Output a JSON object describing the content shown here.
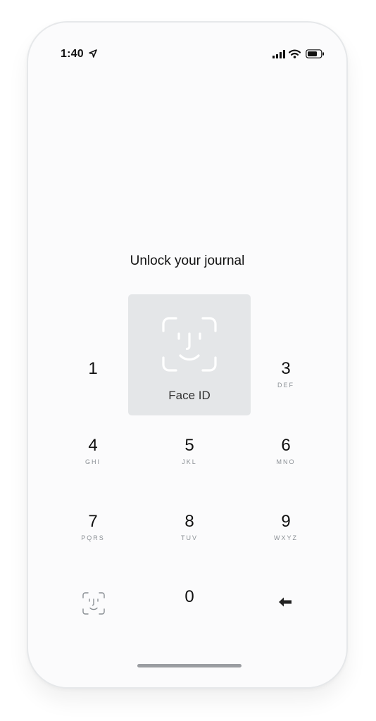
{
  "status_bar": {
    "time": "1:40",
    "icons": [
      "location-arrow-icon",
      "cellular-signal-icon",
      "wifi-icon",
      "battery-icon"
    ]
  },
  "screen": {
    "title": "Unlock your journal",
    "faceid_card": {
      "icon": "face-id-icon",
      "label": "Face ID"
    }
  },
  "keypad": {
    "keys": [
      {
        "digit": "1",
        "letters": ""
      },
      {
        "digit": "3",
        "letters": "DEF"
      },
      {
        "digit": "4",
        "letters": "GHI"
      },
      {
        "digit": "5",
        "letters": "JKL"
      },
      {
        "digit": "6",
        "letters": "MNO"
      },
      {
        "digit": "7",
        "letters": "PQRS"
      },
      {
        "digit": "8",
        "letters": "TUV"
      },
      {
        "digit": "9",
        "letters": "WXYZ"
      },
      {
        "digit": "0",
        "letters": ""
      }
    ],
    "left_icon": "face-id-icon",
    "right_icon": "backspace-arrow-icon"
  },
  "colors": {
    "background": "#fbfbfc",
    "card": "#e4e6e8",
    "text": "#111111",
    "subtext": "#8a8f94",
    "home_indicator": "#9a9da1"
  }
}
